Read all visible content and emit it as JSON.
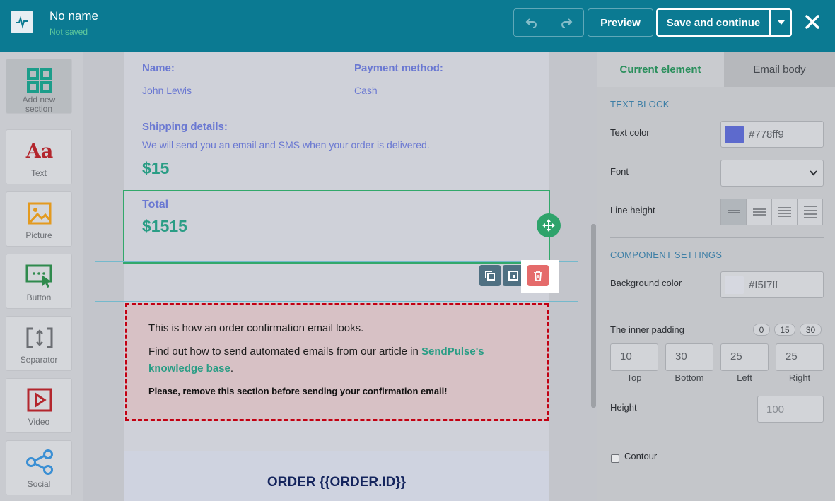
{
  "header": {
    "doc_title": "No name",
    "doc_status": "Not saved",
    "preview_label": "Preview",
    "save_label": "Save and continue",
    "colors": {
      "bar": "#0b7a92",
      "status": "#5fc99c"
    }
  },
  "sidebar": {
    "items": [
      {
        "label": "Add new section",
        "icon": "grid-icon"
      },
      {
        "label": "Text",
        "icon": "text-aa-icon"
      },
      {
        "label": "Picture",
        "icon": "picture-icon"
      },
      {
        "label": "Button",
        "icon": "button-cursor-icon"
      },
      {
        "label": "Separator",
        "icon": "separator-icon"
      },
      {
        "label": "Video",
        "icon": "video-icon"
      },
      {
        "label": "Social",
        "icon": "share-icon"
      }
    ]
  },
  "canvas": {
    "name_label": "Name:",
    "name_value": "John Lewis",
    "payment_label": "Payment method:",
    "payment_value": "Cash",
    "shipping_label": "Shipping details:",
    "shipping_note": "We will send you an email and SMS when your order is delivered.",
    "shipping_price": "$15",
    "total_label": "Total",
    "total_price": "$1515",
    "notice": {
      "line1": "This is how an order confirmation email looks.",
      "line2_prefix": "Find out how to send automated emails from our article in ",
      "line2_link": "SendPulse's knowledge base",
      "line2_suffix": ".",
      "warning": "Please, remove this section before sending your confirmation email!"
    },
    "order_title": "ORDER {{ORDER.ID}}"
  },
  "panel": {
    "tabs": {
      "current": "Current element",
      "body": "Email body"
    },
    "text_block_title": "TEXT BLOCK",
    "text_color_label": "Text color",
    "text_color_value": "#778ff9",
    "font_label": "Font",
    "line_height_label": "Line height",
    "component_title": "COMPONENT SETTINGS",
    "bg_color_label": "Background color",
    "bg_color_value": "#f5f7ff",
    "inner_padding_label": "The inner padding",
    "padding_presets": [
      "0",
      "15",
      "30"
    ],
    "padding": [
      {
        "value": "10",
        "caption": "Top"
      },
      {
        "value": "30",
        "caption": "Bottom"
      },
      {
        "value": "25",
        "caption": "Left"
      },
      {
        "value": "25",
        "caption": "Right"
      }
    ],
    "height_label": "Height",
    "height_placeholder": "100",
    "contour_label": "Contour"
  }
}
